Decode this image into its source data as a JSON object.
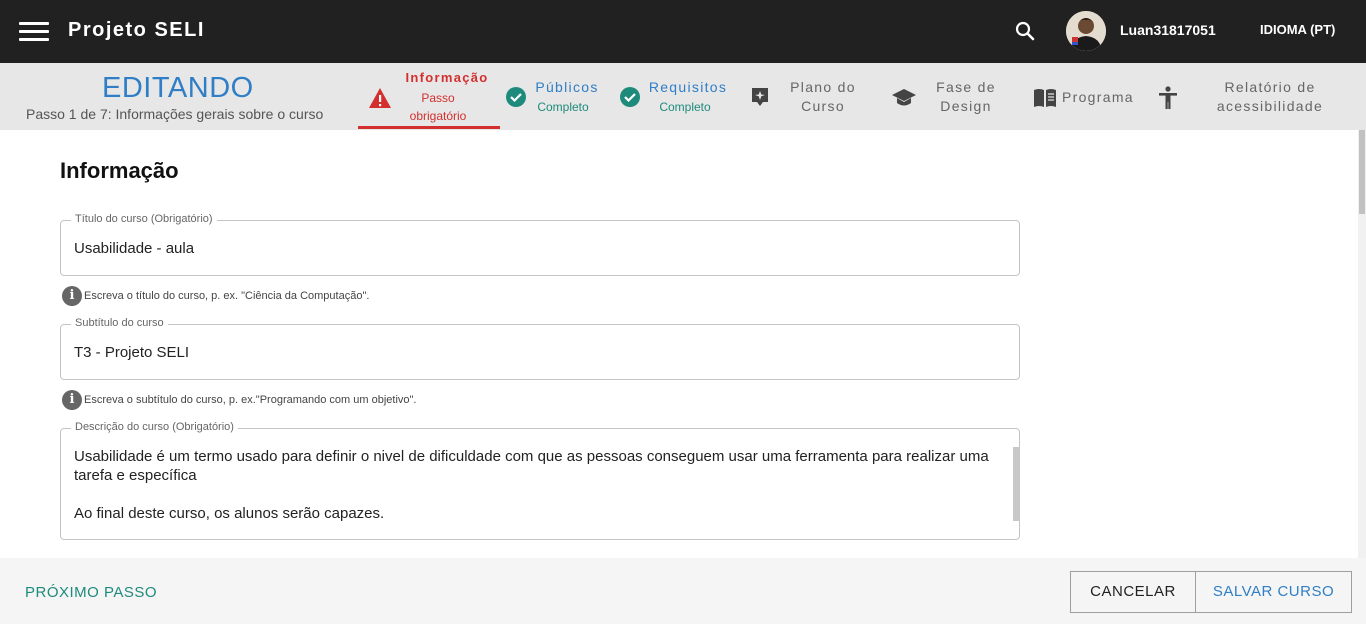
{
  "app": {
    "title": "Projeto SELI",
    "username": "Luan31817051",
    "language": "IDIOMA (PT)"
  },
  "editor": {
    "title": "EDITANDO",
    "step_count": "Passo 1 de 7: Informações gerais sobre o curso"
  },
  "steps": [
    {
      "label": "Informação",
      "status": "Passo obrigatório",
      "status_lines": [
        "Passo",
        "obrigatório"
      ],
      "state": "active-required",
      "icon": "warning-icon"
    },
    {
      "label": "Públicos",
      "status": "Completo",
      "state": "complete",
      "icon": "check-circle-icon"
    },
    {
      "label": "Requisitos",
      "status": "Completo",
      "state": "complete",
      "icon": "check-circle-icon"
    },
    {
      "label_lines": [
        "Plano do",
        "Curso"
      ],
      "state": "pending",
      "icon": "course-plan-icon"
    },
    {
      "label_lines": [
        "Fase de",
        "Design"
      ],
      "state": "pending",
      "icon": "graduation-cap-icon"
    },
    {
      "label": "Programa",
      "state": "pending",
      "icon": "book-icon"
    },
    {
      "label_lines": [
        "Relatório de",
        "acessibilidade"
      ],
      "state": "pending",
      "icon": "accessibility-icon"
    }
  ],
  "form": {
    "section_title": "Informação",
    "title_field": {
      "label": "Título do curso (Obrigatório)",
      "value": "Usabilidade - aula",
      "hint": "Escreva o título do curso, p. ex. \"Ciência da Computação\"."
    },
    "subtitle_field": {
      "label": "Subtítulo do curso",
      "value": "T3 - Projeto SELI",
      "hint": "Escreva o subtítulo do curso, p. ex.\"Programando com um objetivo\"."
    },
    "description_field": {
      "label": "Descrição do curso (Obrigatório)",
      "line1": "Usabilidade é um termo usado para definir o nivel de dificuldade com que as pessoas conseguem usar uma ferramenta para realizar uma tarefa e específica",
      "line2": "Ao final deste curso, os alunos serão capazes."
    }
  },
  "footer": {
    "next_label": "PRÓXIMO PASSO",
    "cancel_label": "CANCELAR",
    "save_label": "SALVAR CURSO"
  },
  "colors": {
    "appbar": "#212121",
    "accent_blue": "#2f7ec6",
    "complete_teal": "#1e8a7c",
    "required_red": "#d32f2f"
  }
}
